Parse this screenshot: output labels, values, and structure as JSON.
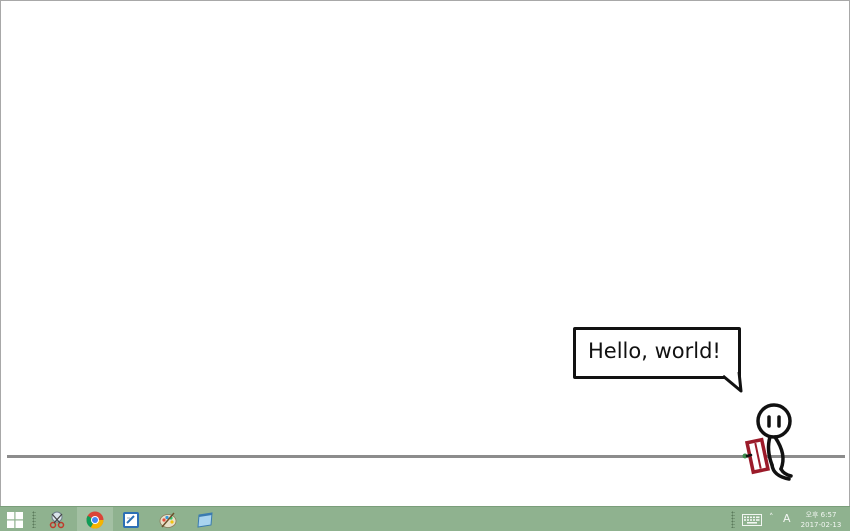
{
  "speech_bubble": {
    "text": "Hello, world!"
  },
  "taskbar": {
    "apps": [
      {
        "name": "snipping-tool"
      },
      {
        "name": "chrome"
      },
      {
        "name": "notepad-editor"
      },
      {
        "name": "paint"
      },
      {
        "name": "app-window"
      }
    ],
    "tray": {
      "overflow_arrow": "˄",
      "ime_indicator": "A",
      "time": "오후 6:57",
      "date": "2017-02-13"
    }
  },
  "colors": {
    "taskbar": "#8fb28f",
    "ground_line": "#8c8c8c",
    "book": "#9b1b2a"
  }
}
